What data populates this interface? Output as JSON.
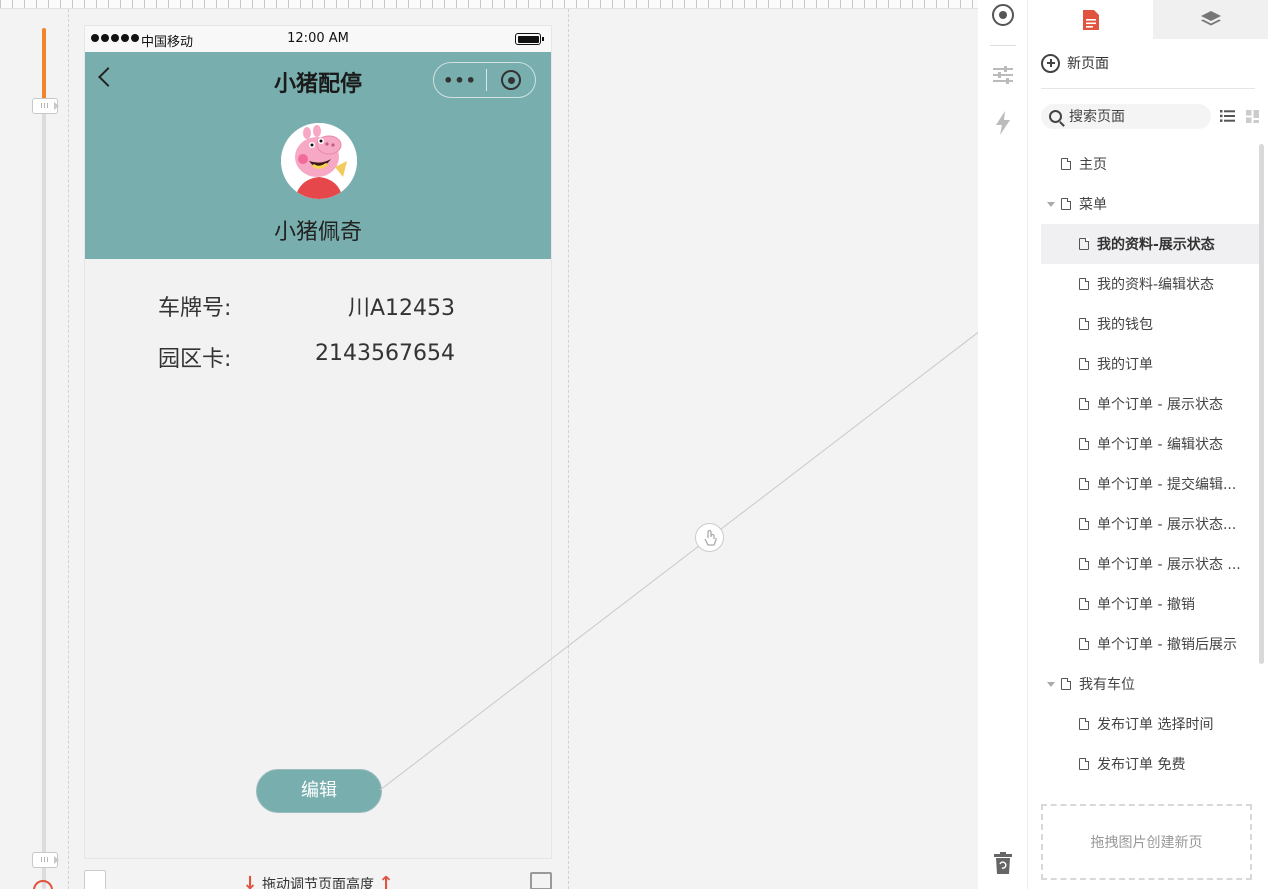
{
  "phone": {
    "status": {
      "carrier": "中国移动",
      "time": "12:00 AM"
    },
    "nav": {
      "title": "小猪配停",
      "more": "•••"
    },
    "user": {
      "name": "小猪佩奇"
    },
    "info": [
      {
        "label": "车牌号:",
        "value": "川A12453"
      },
      {
        "label": "园区卡:",
        "value": "2143567654"
      }
    ],
    "edit_button": "编辑"
  },
  "canvas": {
    "resize_hint": "拖动调节页面高度",
    "slider_handle": "III"
  },
  "panel": {
    "new_page_label": "新页面",
    "search_placeholder": "搜索页面",
    "pages": [
      {
        "label": "主页",
        "level": 0,
        "expandable": false,
        "selected": false
      },
      {
        "label": "菜单",
        "level": 0,
        "expandable": true,
        "selected": false
      },
      {
        "label": "我的资料-展示状态",
        "level": 1,
        "expandable": false,
        "selected": true
      },
      {
        "label": "我的资料-编辑状态",
        "level": 1,
        "expandable": false,
        "selected": false
      },
      {
        "label": "我的钱包",
        "level": 1,
        "expandable": false,
        "selected": false
      },
      {
        "label": "我的订单",
        "level": 1,
        "expandable": false,
        "selected": false
      },
      {
        "label": "单个订单 - 展示状态",
        "level": 1,
        "expandable": false,
        "selected": false
      },
      {
        "label": "单个订单 - 编辑状态",
        "level": 1,
        "expandable": false,
        "selected": false
      },
      {
        "label": "单个订单 - 提交编辑...",
        "level": 1,
        "expandable": false,
        "selected": false
      },
      {
        "label": "单个订单 - 展示状态...",
        "level": 1,
        "expandable": false,
        "selected": false
      },
      {
        "label": "单个订单 - 展示状态 ...",
        "level": 1,
        "expandable": false,
        "selected": false
      },
      {
        "label": "单个订单 - 撤销",
        "level": 1,
        "expandable": false,
        "selected": false
      },
      {
        "label": "单个订单 - 撤销后展示",
        "level": 1,
        "expandable": false,
        "selected": false
      },
      {
        "label": "我有车位",
        "level": 0,
        "expandable": true,
        "selected": false
      },
      {
        "label": "发布订单 选择时间",
        "level": 1,
        "expandable": false,
        "selected": false
      },
      {
        "label": "发布订单 免费",
        "level": 1,
        "expandable": false,
        "selected": false
      }
    ],
    "drop_zone": "拖拽图片创建新页"
  },
  "colors": {
    "accent": "#f0862c",
    "header_teal": "#79aeae",
    "page_tab_icon": "#e0533f"
  },
  "icons": {
    "icon_bar": [
      "target-icon",
      "sliders-icon",
      "lightning-icon",
      "recycle-bin-icon"
    ],
    "tabs": [
      "page-doc-icon",
      "layers-icon"
    ]
  }
}
